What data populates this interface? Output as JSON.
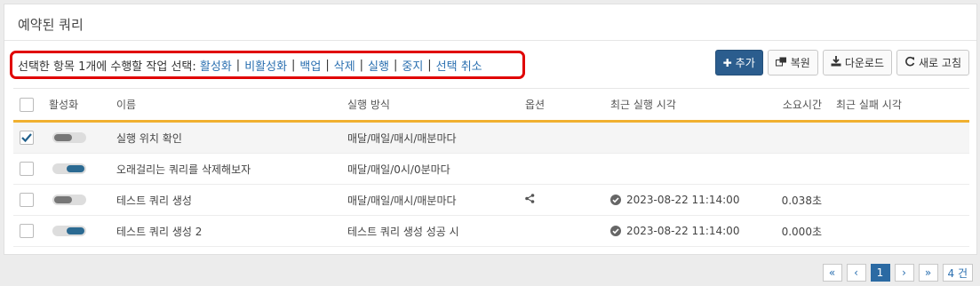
{
  "panel": {
    "title": "예약된 쿼리"
  },
  "actionbar": {
    "prefix": "선택한 항목 1개에 수행할 작업 선택:",
    "actions": [
      "활성화",
      "비활성화",
      "백업",
      "삭제",
      "실행",
      "중지",
      "선택 취소"
    ]
  },
  "toolbar": {
    "add": "추가",
    "restore": "복원",
    "download": "다운로드",
    "refresh": "새로 고침"
  },
  "table": {
    "headers": {
      "active": "활성화",
      "name": "이름",
      "mode": "실행 방식",
      "option": "옵션",
      "last_run": "최근 실행 시각",
      "duration": "소요시간",
      "last_fail": "최근 실패 시각"
    },
    "rows": [
      {
        "checked": true,
        "active": false,
        "name": "실행 위치 확인",
        "mode": "매달/매일/매시/매분마다",
        "shared": false,
        "last_run": "",
        "duration": "",
        "last_fail": ""
      },
      {
        "checked": false,
        "active": true,
        "name": "오래걸리는 쿼리를 삭제해보자",
        "mode": "매달/매일/0시/0분마다",
        "shared": false,
        "last_run": "",
        "duration": "",
        "last_fail": ""
      },
      {
        "checked": false,
        "active": false,
        "name": "테스트 쿼리 생성",
        "mode": "매달/매일/매시/매분마다",
        "shared": true,
        "last_run": "2023-08-22 11:14:00",
        "duration": "0.038초",
        "last_fail": ""
      },
      {
        "checked": false,
        "active": true,
        "name": "테스트 쿼리 생성 2",
        "mode": "테스트 쿼리 생성 성공 시",
        "shared": false,
        "last_run": "2023-08-22 11:14:00",
        "duration": "0.000초",
        "last_fail": ""
      }
    ]
  },
  "pager": {
    "first": "«",
    "prev": "‹",
    "current": "1",
    "next": "›",
    "last": "»",
    "count": "4 건"
  },
  "colors": {
    "accent": "#2b5d8e",
    "highlight_border": "#e00000",
    "header_rule": "#f0b030",
    "link": "#2a6fb0"
  }
}
